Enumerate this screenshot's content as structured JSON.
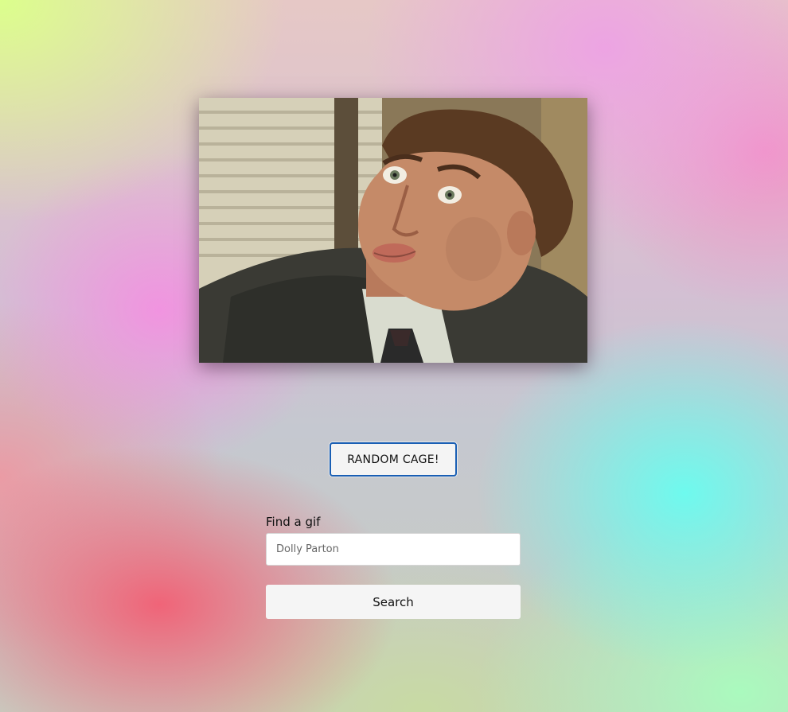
{
  "gif": {
    "subject_icon": "surprised-face-photo"
  },
  "random_button": {
    "label": "RANDOM CAGE!"
  },
  "search_form": {
    "label": "Find a gif",
    "input_placeholder": "Dolly Parton",
    "input_value": "",
    "submit_label": "Search"
  },
  "colors": {
    "button_focus_border": "#1a5fb4",
    "button_background": "#f5f5f5",
    "input_background": "#ffffff"
  }
}
